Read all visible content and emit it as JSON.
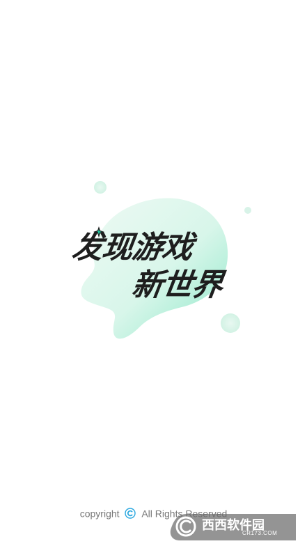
{
  "splash": {
    "slogan_line1": "发现游戏",
    "slogan_line2": "新世界"
  },
  "footer": {
    "copyright_prefix": "copyright",
    "copyright_icon": "copyright-c-icon",
    "rights_text": "All Rights Reserved"
  },
  "watermark": {
    "site_name": "西西软件园",
    "site_domain": "CR173.COM"
  },
  "colors": {
    "blob_light": "#e7f9ef",
    "blob_teal": "#7fe3c3",
    "slogan_text": "#1e1e1e",
    "accent_sparkle": "#1fc8a0",
    "footer_text": "#777777",
    "copyright_icon": "#2aa8e0"
  }
}
